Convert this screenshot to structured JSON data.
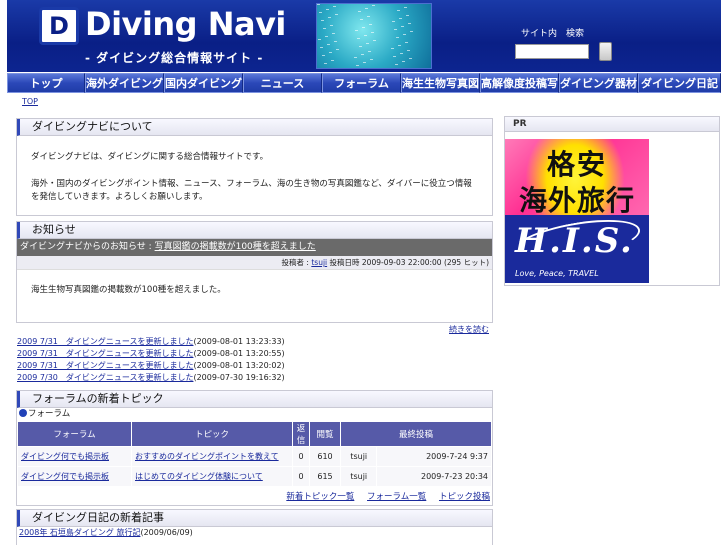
{
  "header": {
    "logo_mark": "D",
    "logo_title": "Diving Navi",
    "logo_subtitle": "- ダイビング総合情報サイト -",
    "search_label_1": "サイト内",
    "search_label_2": "検索",
    "search_placeholder": ""
  },
  "nav": [
    {
      "label": "トップ",
      "width": 78
    },
    {
      "label": "海外ダイビング",
      "width": 79
    },
    {
      "label": "国内ダイビング",
      "width": 79
    },
    {
      "label": "ニュース",
      "width": 79
    },
    {
      "label": "フォーラム",
      "width": 79
    },
    {
      "label": "海生生物写真図鑑",
      "width": 79
    },
    {
      "label": "高解像度投稿写真",
      "width": 79
    },
    {
      "label": "ダイビング器材",
      "width": 79
    },
    {
      "label": "ダイビング日記",
      "width": 83
    }
  ],
  "breadcrumb": "TOP",
  "about": {
    "title": "ダイビングナビについて",
    "p1": "ダイビングナビは、ダイビングに関する総合情報サイトです。",
    "p2": "海外・国内のダイビングポイント情報、ニュース、フォーラム、海の生き物の写真図鑑など、ダイバーに役立つ情報を発信していきます。よろしくお願いします。"
  },
  "notice": {
    "title": "お知らせ",
    "head_prefix": "ダイビングナビからのお知らせ :",
    "head_link": "写真図鑑の掲載数が100種を超えました",
    "meta_prefix": "投稿者 :",
    "meta_author": "tsuji",
    "meta_suffix": "投稿日時 2009-09-03 22:00:00 (295 ヒット)",
    "body": "海生生物写真図鑑の掲載数が100種を超えました。",
    "more": "続きを読む"
  },
  "news": [
    {
      "link": "2009 7/31　ダイビングニュースを更新しました",
      "date": "(2009-08-01 13:23:33)"
    },
    {
      "link": "2009 7/31　ダイビングニュースを更新しました",
      "date": "(2009-08-01 13:20:55)"
    },
    {
      "link": "2009 7/31　ダイビングニュースを更新しました",
      "date": "(2009-08-01 13:20:02)"
    },
    {
      "link": "2009 7/30　ダイビングニュースを更新しました",
      "date": "(2009-07-30 19:16:32)"
    }
  ],
  "forum": {
    "title": "フォーラムの新着トピック",
    "sub": "フォーラム",
    "headers": [
      "フォーラム",
      "トピック",
      "返信",
      "閲覧",
      "最終投稿"
    ],
    "rows": [
      {
        "forum": "ダイビング何でも掲示板",
        "topic": "おすすめのダイビングポイントを教えて",
        "replies": "0",
        "views": "610",
        "user": "tsuji",
        "date": "2009-7-24 9:37"
      },
      {
        "forum": "ダイビング何でも掲示板",
        "topic": "はじめてのダイビング体験について",
        "replies": "0",
        "views": "615",
        "user": "tsuji",
        "date": "2009-7-23 20:34"
      }
    ],
    "links": [
      "新着トピック一覧",
      "フォーラム一覧",
      "トピック投稿"
    ]
  },
  "diary": {
    "title": "ダイビング日記の新着記事",
    "link": "2008年 石垣島ダイビング 旅行記",
    "date": "(2009/06/09)"
  },
  "pr": {
    "title": "PR",
    "line1": "格安",
    "line2": "海外旅行",
    "brand": "H.I.S.",
    "tagline": "Love, Peace, TRAVEL"
  }
}
